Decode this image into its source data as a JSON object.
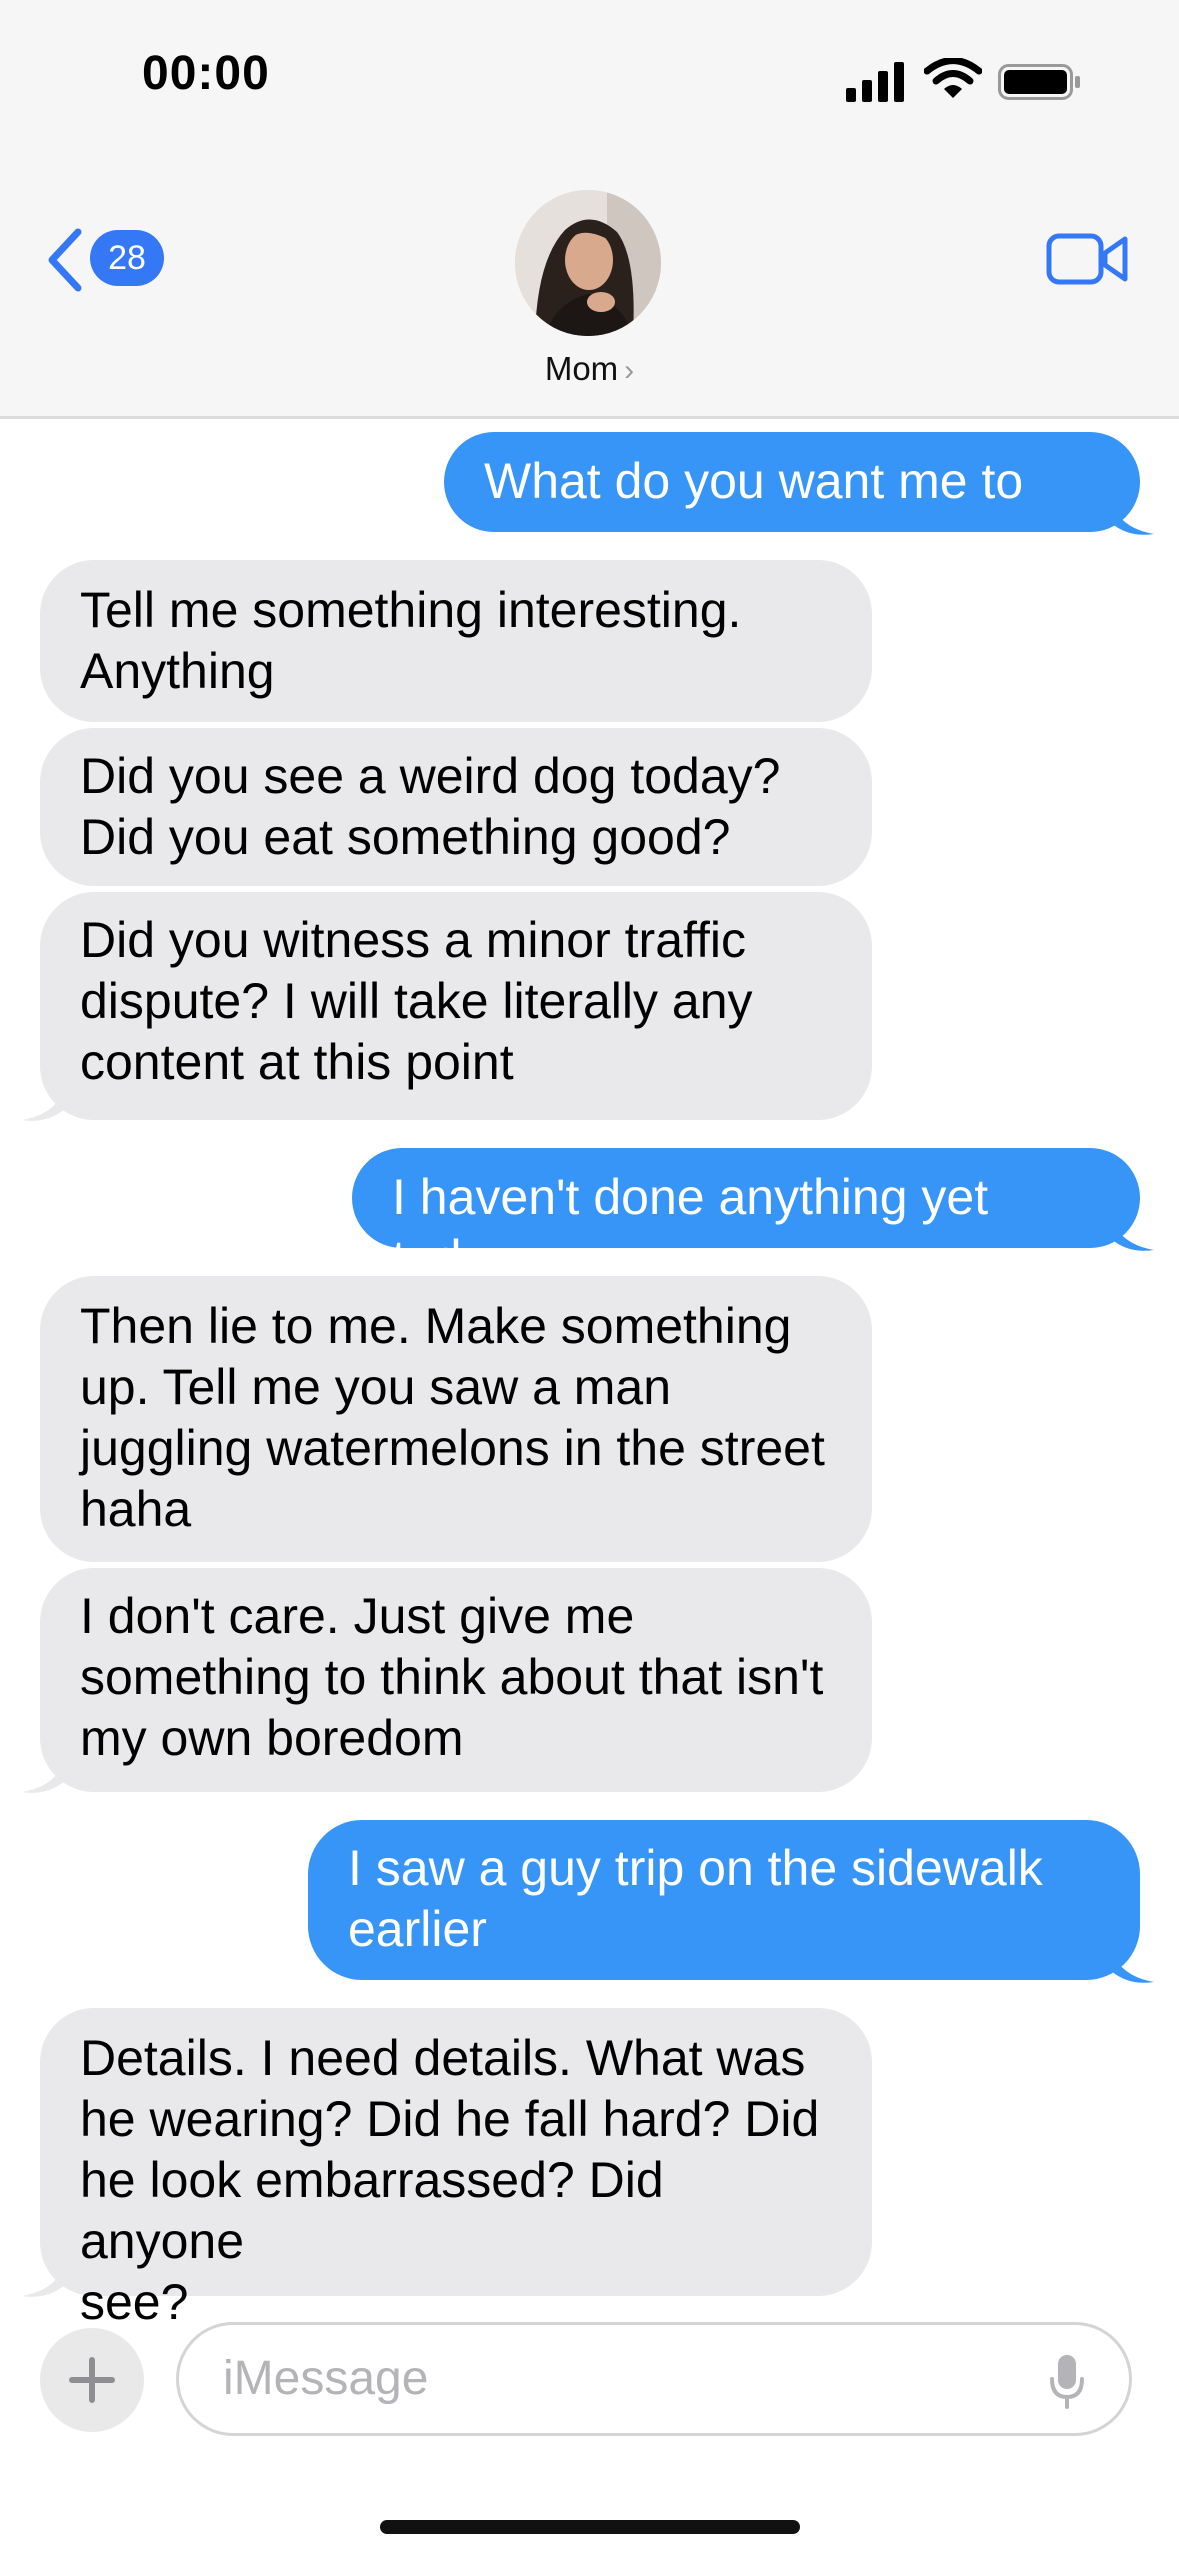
{
  "status_bar": {
    "time": "00:00"
  },
  "header": {
    "back_count": "28",
    "contact_name": "Mom",
    "contact_chevron": "›"
  },
  "messages": [
    {
      "side": "outgoing",
      "text": "What do you want me to say"
    },
    {
      "side": "incoming",
      "text": " Tell me something interesting.\nAnything"
    },
    {
      "side": "incoming",
      "text": "Did you see a weird dog today?\nDid you eat something good?"
    },
    {
      "side": "incoming",
      "text": "Did you witness a minor traffic\ndispute? I will take literally any\ncontent at this point"
    },
    {
      "side": "outgoing",
      "text": "I haven't done anything yet today"
    },
    {
      "side": "incoming",
      "text": "Then lie to me. Make something\nup. Tell me you saw a man\njuggling watermelons in the street\nhaha"
    },
    {
      "side": "incoming",
      "text": "I don't care. Just give me\nsomething to think about that isn't\nmy own boredom"
    },
    {
      "side": "outgoing",
      "text": "I saw a guy trip on the sidewalk\nearlier"
    },
    {
      "side": "incoming",
      "text": "Details. I need details. What was\nhe wearing? Did he fall hard? Did\nhe look embarrassed? Did anyone\nsee?"
    }
  ],
  "composer": {
    "placeholder": "iMessage"
  },
  "colors": {
    "outgoing_bubble": "#3695f7",
    "incoming_bubble": "#e9e9eb",
    "accent": "#3478f6"
  },
  "icons": [
    "signal-icon",
    "wifi-icon",
    "battery-icon",
    "back-chevron-icon",
    "video-camera-icon",
    "plus-icon",
    "microphone-icon"
  ]
}
